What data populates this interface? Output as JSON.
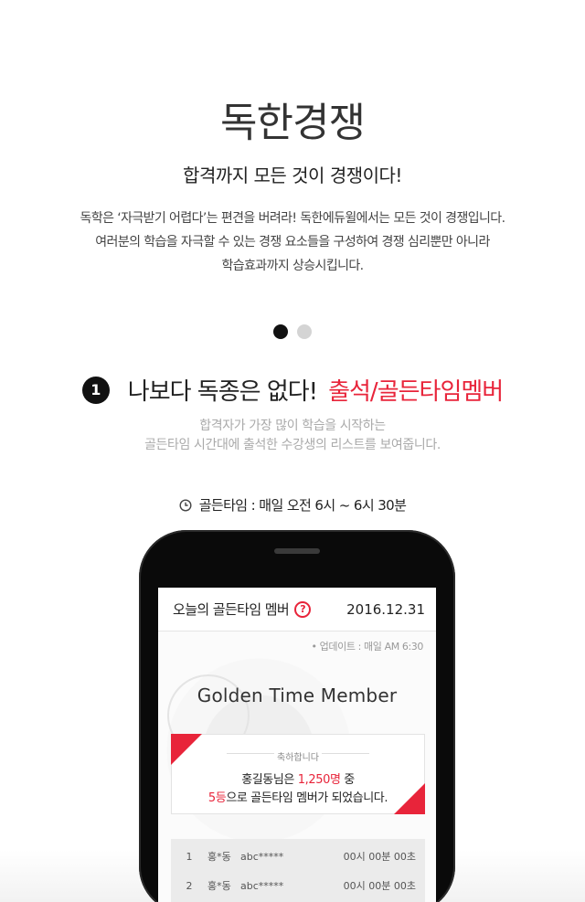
{
  "header": {
    "title": "독한경쟁",
    "subtitle": "합격까지 모든 것이 경쟁이다!",
    "description": [
      "독학은 ‘자극받기 어렵다’는 편견을 버려라! 독한에듀윌에서는 모든 것이 경쟁입니다.",
      "여러분의 학습을 자극할 수 있는 경쟁 요소들을 구성하여 경쟁 심리뿐만 아니라",
      "학습효과까지 상승시킵니다."
    ]
  },
  "pagination": {
    "count": 2,
    "active": 1
  },
  "section": {
    "number": "1",
    "headline_black": "나보다 독종은 없다!",
    "headline_red": "출석/골든타임멤버",
    "description": [
      "합격자가 가장 많이 학습을 시작하는",
      "골든타임 시간대에 출석한 수강생의 리스트를 보여줍니다."
    ],
    "golden_time": "골든타임 : 매일 오전 6시 ~ 6시 30분"
  },
  "phone_screen": {
    "title": "오늘의 골든타임 멤버",
    "help_icon": "?",
    "date": "2016.12.31",
    "update": "• 업데이트 : 매일 AM 6:30",
    "hero_title": "Golden Time Member",
    "congrats_label": "축하합니다",
    "congrats_line1_a": "홍길동님은 ",
    "congrats_line1_b": "1,250명",
    "congrats_line1_c": " 중",
    "congrats_line2_a": "5등",
    "congrats_line2_b": "으로 골든타임 멤버가 되었습니다.",
    "rows": [
      {
        "rank": "1",
        "name": "홍*동",
        "id": "abc*****",
        "time": "00시 00분 00초"
      },
      {
        "rank": "2",
        "name": "홍*동",
        "id": "abc*****",
        "time": "00시 00분 00초"
      }
    ]
  },
  "colors": {
    "accent": "#e8243a",
    "dot_active": "#111111",
    "dot_inactive": "#d4d4d4"
  }
}
